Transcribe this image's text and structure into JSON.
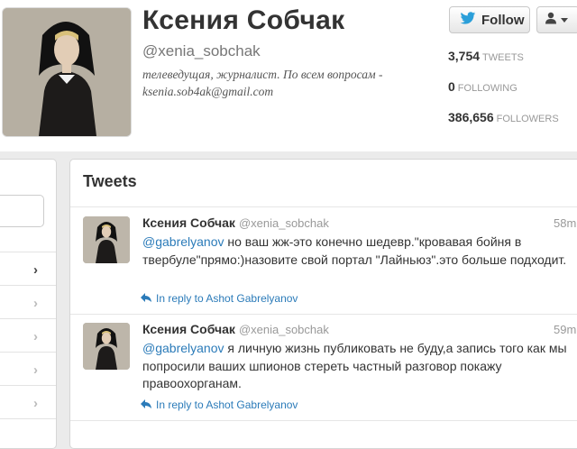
{
  "profile": {
    "name": "Ксения Собчак",
    "handle": "@xenia_sobchak",
    "bio": "телеведущая, журналист. По всем вопросам - ksenia.sob4ak@gmail.com",
    "avatar_icon": "profile-photo"
  },
  "actions": {
    "follow_label": "Follow",
    "follow_icon": "twitter-bird-icon",
    "user_menu_icon": "person-icon",
    "accent": "#2b7bb9"
  },
  "stats": [
    {
      "value": "3,754",
      "label": "TWEETS"
    },
    {
      "value": "0",
      "label": "FOLLOWING"
    },
    {
      "value": "386,656",
      "label": "FOLLOWERS"
    }
  ],
  "tweets_panel": {
    "title": "Tweets",
    "tweets": [
      {
        "author": "Ксения Собчак",
        "handle": "@xenia_sobchak",
        "time": "58m",
        "mention": "@gabrelyanov",
        "text": " но ваш жж-это конечно шедевр.\"кровавая бойня в твербуле\"прямо:)назовите свой портал \"Лайньюз\".это больше подходит.",
        "reply_label": "In reply to Ashot Gabrelyanov"
      },
      {
        "author": "Ксения Собчак",
        "handle": "@xenia_sobchak",
        "time": "59m",
        "mention": "@gabrelyanov",
        "text": " я личную жизнь публиковать не буду,а запись того как мы попросили ваших шпионов стереть частный разговор покажу правоохорганам.",
        "reply_label": "In reply to Ashot Gabrelyanov"
      }
    ]
  },
  "sidebar": {
    "nav_icon": "chevron-right-icon",
    "nav_glyph": "›"
  }
}
